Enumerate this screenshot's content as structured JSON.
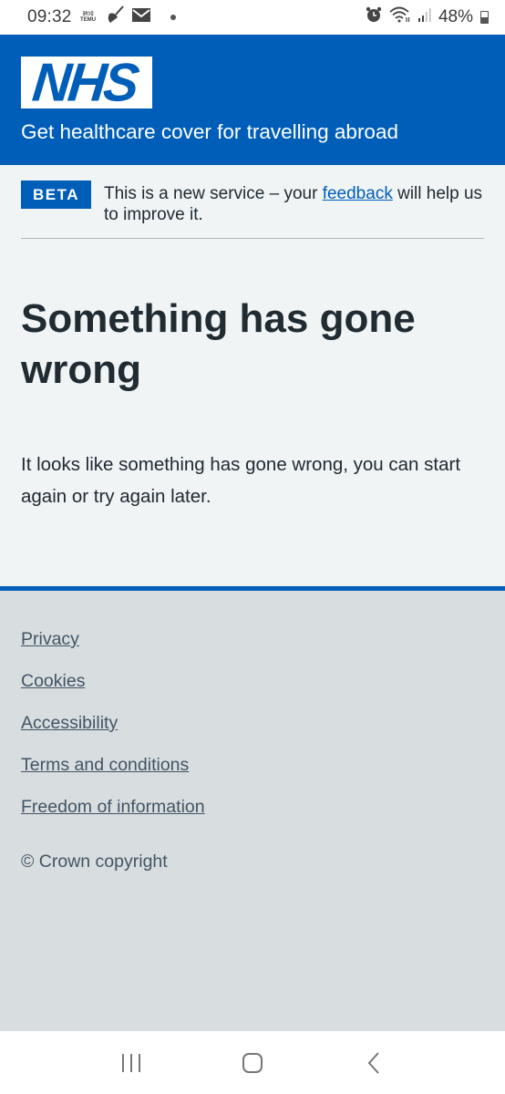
{
  "status_bar": {
    "time": "09:32",
    "notification_icons": [
      "temu-icon",
      "broom-icon",
      "mail-icon",
      "dot-icon"
    ],
    "temu_label_top": "ﾖｷﾝﾛ",
    "temu_label_bottom": "TEMU",
    "system_icons": [
      "alarm-icon",
      "wifi-icon",
      "signal-icon",
      "battery-icon"
    ],
    "battery": "48%"
  },
  "header": {
    "logo_text": "NHS",
    "service_name": "Get healthcare cover for travelling abroad"
  },
  "beta_banner": {
    "tag": "BETA",
    "text_before": "This is a new service – your ",
    "link_text": "feedback",
    "text_after": " will help us to improve it."
  },
  "main": {
    "title": "Something has gone wrong",
    "body": "It looks like something has gone wrong, you can start again or try again later."
  },
  "footer": {
    "links": [
      {
        "label": "Privacy"
      },
      {
        "label": "Cookies"
      },
      {
        "label": "Accessibility"
      },
      {
        "label": "Terms and conditions"
      },
      {
        "label": "Freedom of information"
      }
    ],
    "copyright": "© Crown copyright"
  },
  "nav_bar": {
    "buttons": [
      "recents-icon",
      "home-icon",
      "back-icon"
    ]
  },
  "colors": {
    "nhs_blue": "#005eb8",
    "text": "#212b32",
    "footer_text": "#425563",
    "page_bg": "#f0f4f5",
    "footer_bg": "#d8dde0"
  }
}
